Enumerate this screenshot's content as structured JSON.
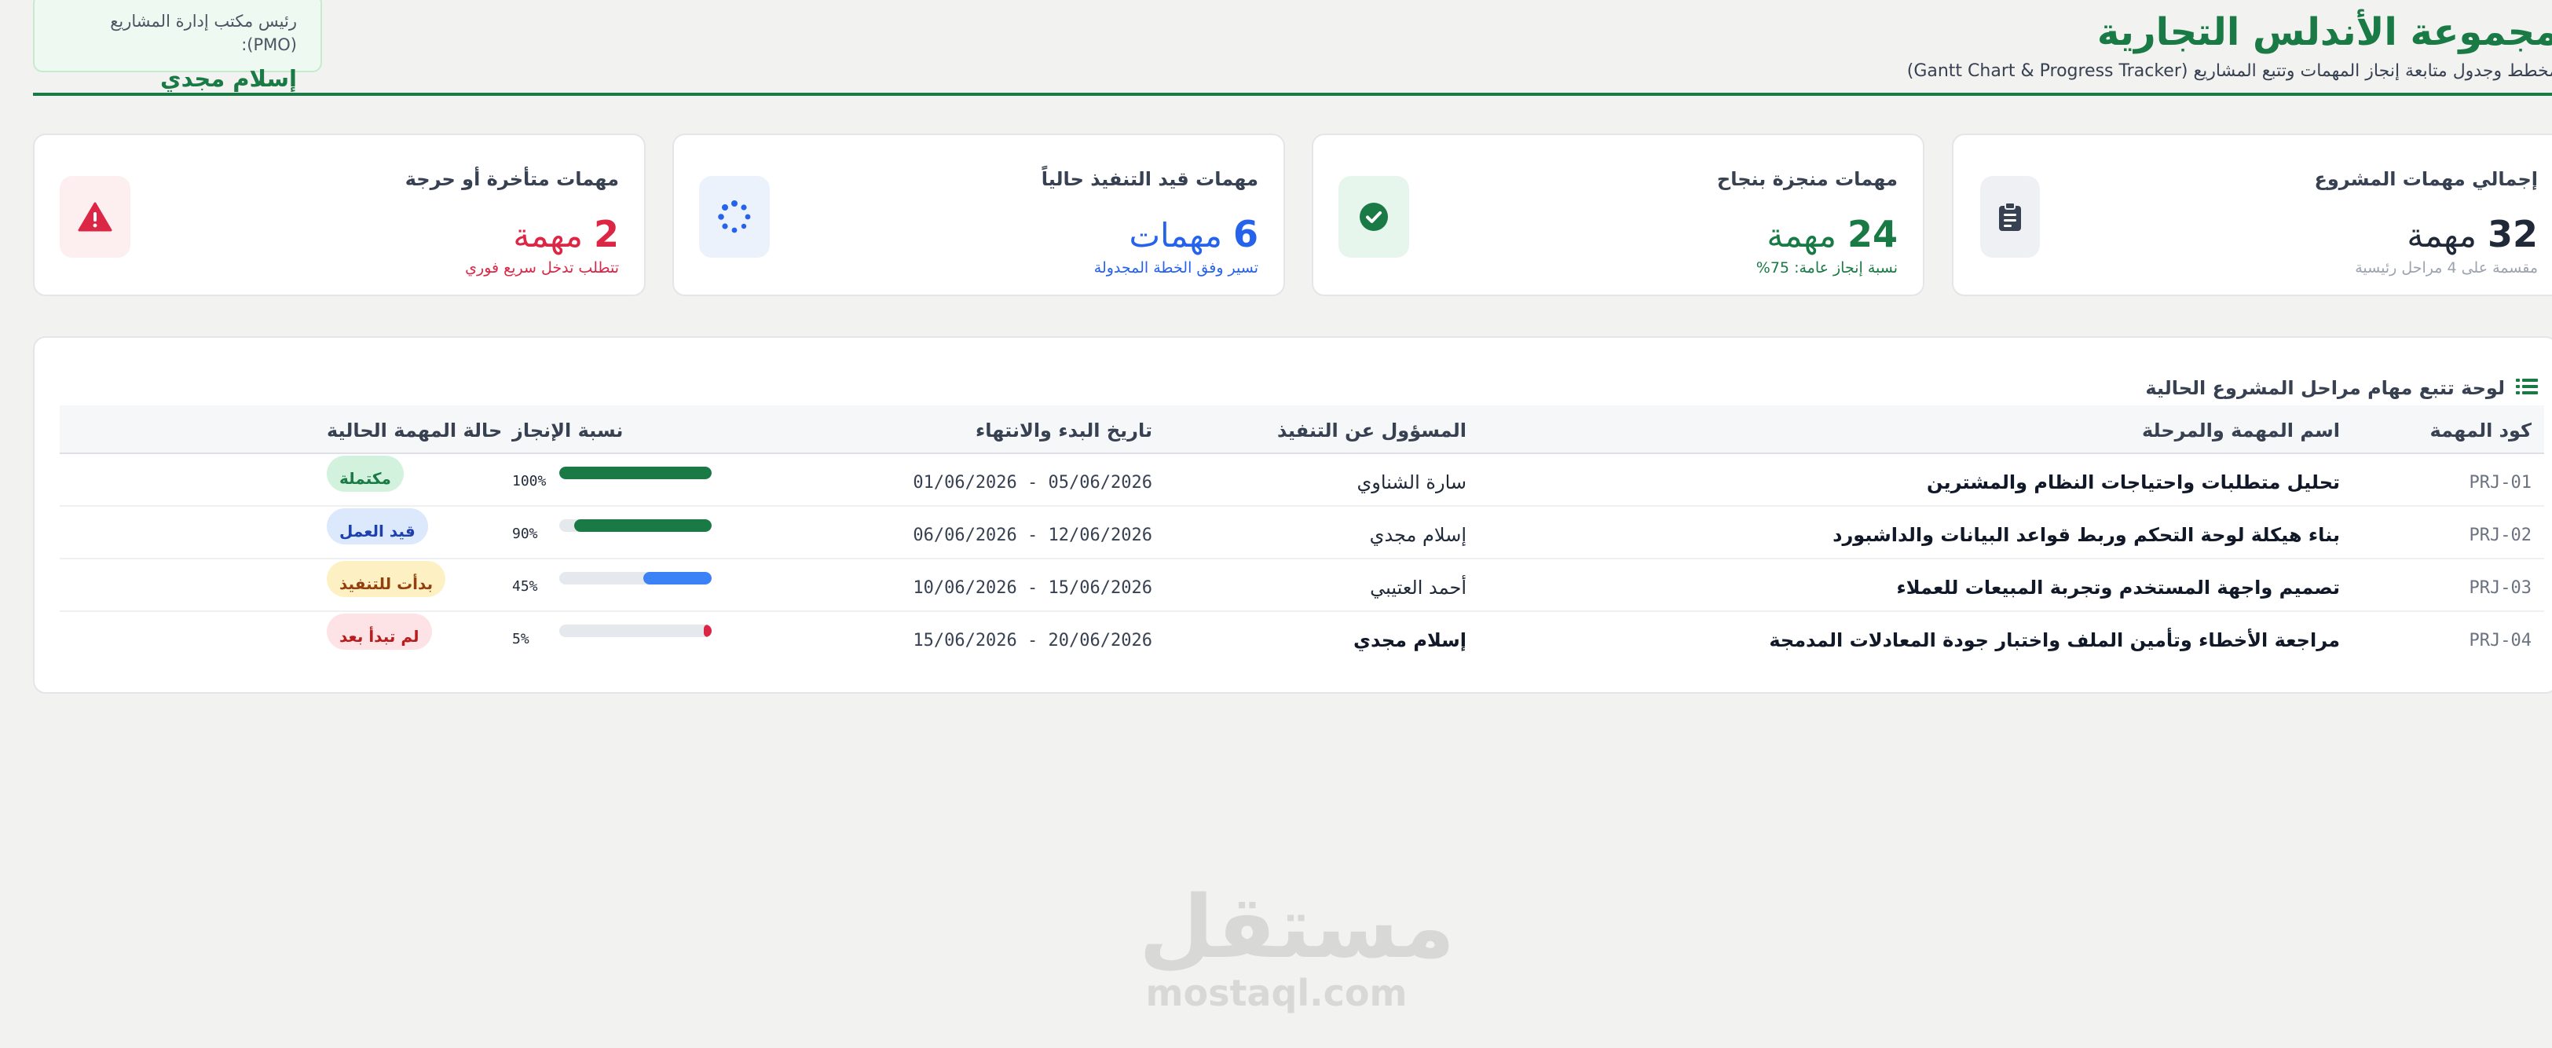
{
  "header": {
    "title": "مجموعة الأندلس التجارية",
    "subtitle": "مخطط وجدول متابعة إنجاز المهمات وتتبع المشاريع (Gantt Chart & Progress Tracker)",
    "pmo_label": "رئيس مكتب إدارة المشاريع (PMO):",
    "pmo_name": "إسلام مجدي"
  },
  "cards": [
    {
      "label": "إجمالي مهمات المشروع",
      "number": "32",
      "unit": "مهمة",
      "note": "مقسمة على 4 مراحل رئيسية",
      "icon": "clipboard-icon",
      "color": "#1f2937",
      "note_color": "#9ca3af",
      "icon_bg": "#eef0f3"
    },
    {
      "label": "مهمات منجزة بنجاح",
      "number": "24",
      "unit": "مهمة",
      "note": "نسبة إنجاز عامة: 75%",
      "icon": "check-circle-icon",
      "color": "#1a7a45",
      "note_color": "#1a7a45",
      "icon_bg": "#e7f6ec"
    },
    {
      "label": "مهمات قيد التنفيذ حالياً",
      "number": "6",
      "unit": "مهمات",
      "note": "تسير وفق الخطة المجدولة",
      "icon": "spinner-icon",
      "color": "#2563eb",
      "note_color": "#2563eb",
      "icon_bg": "#ecf2fb"
    },
    {
      "label": "مهمات متأخرة أو حرجة",
      "number": "2",
      "unit": "مهمة",
      "note": "تتطلب تدخل سريع فوري",
      "icon": "warning-icon",
      "color": "#dc2645",
      "note_color": "#dc2645",
      "icon_bg": "#fdeef0"
    }
  ],
  "panel": {
    "title": "لوحة تتبع مهام مراحل المشروع الحالية",
    "icon": "list-icon",
    "columns": {
      "code": "كود المهمة",
      "name": "اسم المهمة والمرحلة",
      "owner": "المسؤول عن التنفيذ",
      "dates": "تاريخ البدء والانتهاء",
      "progress": "نسبة الإنجاز",
      "status": "حالة المهمة الحالية"
    },
    "rows": [
      {
        "code": "PRJ-01",
        "name": "تحليل متطلبات واحتياجات النظام والمشترين",
        "owner": "سارة الشناوي",
        "dates": "05/06/2026 - 01/06/2026",
        "progress": 100,
        "progress_label": "100%",
        "bar_color": "#1a7a45",
        "status": "مكتملة",
        "status_bg": "#d3f2dd",
        "status_fg": "#1a7a45"
      },
      {
        "code": "PRJ-02",
        "name": "بناء هيكلة لوحة التحكم وربط قواعد البيانات والداشبورد",
        "owner": "إسلام مجدي",
        "dates": "12/06/2026 - 06/06/2026",
        "progress": 90,
        "progress_label": "90%",
        "bar_color": "#1a7a45",
        "status": "قيد العمل",
        "status_bg": "#dce8fb",
        "status_fg": "#1e40af"
      },
      {
        "code": "PRJ-03",
        "name": "تصميم واجهة المستخدم وتجربة المبيعات للعملاء",
        "owner": "أحمد العتيبي",
        "dates": "15/06/2026 - 10/06/2026",
        "progress": 45,
        "progress_label": "45%",
        "bar_color": "#3b82f6",
        "status": "بدأت للتنفيذ",
        "status_bg": "#fdf1c4",
        "status_fg": "#92400e"
      },
      {
        "code": "PRJ-04",
        "name": "مراجعة الأخطاء وتأمين الملف واختبار جودة المعادلات المدمجة",
        "owner": "إسلام مجدي",
        "owner_bold": true,
        "dates": "20/06/2026 - 15/06/2026",
        "progress": 5,
        "progress_label": "5%",
        "bar_color": "#dc2645",
        "status": "لم تبدأ بعد",
        "status_bg": "#fde2e6",
        "status_fg": "#b91c1c"
      }
    ]
  },
  "watermark": {
    "arabic": "مستقل",
    "latin": "mostaql.com"
  }
}
